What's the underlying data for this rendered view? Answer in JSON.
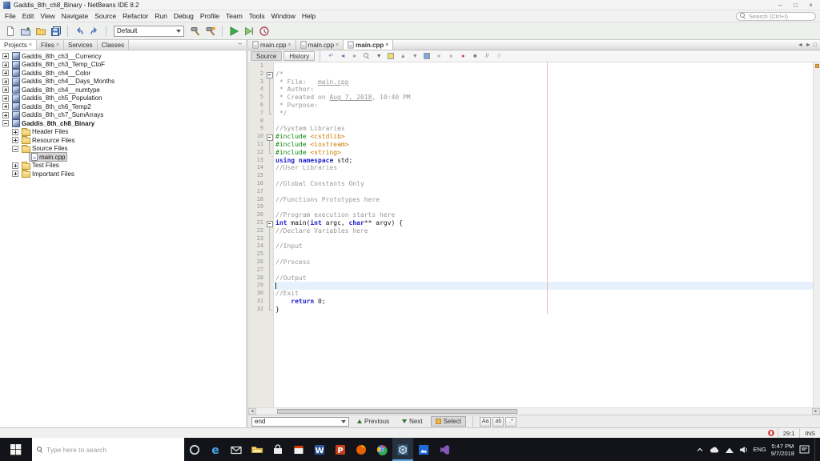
{
  "window": {
    "title": "Gaddis_8th_ch8_Binary - NetBeans IDE 8.2",
    "controls": {
      "minimize": "–",
      "maximize": "□",
      "close": "×"
    }
  },
  "menu_bar": {
    "items": [
      "File",
      "Edit",
      "View",
      "Navigate",
      "Source",
      "Refactor",
      "Run",
      "Debug",
      "Profile",
      "Team",
      "Tools",
      "Window",
      "Help"
    ],
    "search_placeholder": "Search (Ctrl+I)"
  },
  "toolbar": {
    "config_value": "Default",
    "items": [
      {
        "name": "new-file"
      },
      {
        "name": "new-project"
      },
      {
        "name": "open-project"
      },
      {
        "name": "save-all"
      },
      {
        "sep": true
      },
      {
        "name": "undo"
      },
      {
        "name": "redo"
      },
      {
        "sep": true
      },
      {
        "combo": true
      },
      {
        "name": "build-project"
      },
      {
        "name": "clean-build-project"
      },
      {
        "sep": true
      },
      {
        "name": "run-project"
      },
      {
        "name": "debug-project"
      },
      {
        "name": "profile-project"
      }
    ]
  },
  "left_panel": {
    "tabs": [
      {
        "label": "Projects",
        "closable": true,
        "active": true
      },
      {
        "label": "Files",
        "closable": true
      },
      {
        "label": "Services"
      },
      {
        "label": "Classes"
      }
    ],
    "tree": [
      {
        "label": "Gaddis_8th_ch3__Currency",
        "icon": "project",
        "toggle": "plus",
        "level": 0
      },
      {
        "label": "Gaddis_8th_ch3_Temp_CtoF",
        "icon": "project",
        "toggle": "plus",
        "level": 0
      },
      {
        "label": "Gaddis_8th_ch4__Color",
        "icon": "project",
        "toggle": "plus",
        "level": 0
      },
      {
        "label": "Gaddis_8th_ch4__Days_Months",
        "icon": "project",
        "toggle": "plus",
        "level": 0
      },
      {
        "label": "Gaddis_8th_ch4__numtype",
        "icon": "project",
        "toggle": "plus",
        "level": 0
      },
      {
        "label": "Gaddis_8th_ch5_Population",
        "icon": "project",
        "toggle": "plus",
        "level": 0
      },
      {
        "label": "Gaddis_8th_ch6_Temp2",
        "icon": "project",
        "toggle": "plus",
        "level": 0
      },
      {
        "label": "Gaddis_8th_ch7_SumArrays",
        "icon": "project",
        "toggle": "plus",
        "level": 0
      },
      {
        "label": "Gaddis_8th_ch8_Binary",
        "icon": "project",
        "toggle": "minus",
        "level": 0,
        "bold": true
      },
      {
        "label": "Header Files",
        "icon": "folder",
        "toggle": "plus",
        "level": 1
      },
      {
        "label": "Resource Files",
        "icon": "folder",
        "toggle": "plus",
        "level": 1
      },
      {
        "label": "Source Files",
        "icon": "folder",
        "toggle": "minus",
        "level": 1
      },
      {
        "label": "main.cpp",
        "icon": "cpp",
        "toggle": "none",
        "level": 2,
        "selected": true
      },
      {
        "label": "Test Files",
        "icon": "folder",
        "toggle": "plus",
        "level": 1
      },
      {
        "label": "Important Files",
        "icon": "folder",
        "toggle": "plus",
        "level": 1
      }
    ]
  },
  "editor": {
    "source_label": "Source",
    "history_label": "History",
    "tabs": [
      {
        "label": "main.cpp"
      },
      {
        "label": "main.cpp"
      },
      {
        "label": "main.cpp",
        "active": true
      }
    ],
    "toolbar_icons": [
      "last-edit-position",
      "back",
      "forward",
      "find-selection",
      "find-next-occurrence",
      "toggle-highlight-search",
      "previous-bookmark",
      "next-bookmark",
      "toggle-bookmark",
      "shift-line-left",
      "shift-line-right",
      "start-macro-recording",
      "stop-macro-recording",
      "comment-lines",
      "uncomment-lines"
    ],
    "current_line": 29,
    "code_lines": [
      {
        "fold": "",
        "tokens": []
      },
      {
        "fold": "start",
        "tokens": [
          [
            "/*",
            "c"
          ]
        ]
      },
      {
        "fold": "mid",
        "tokens": [
          [
            " * File:   ",
            "c"
          ],
          [
            "main.cpp",
            "cu"
          ]
        ]
      },
      {
        "fold": "mid",
        "tokens": [
          [
            " * Author:",
            "c"
          ]
        ]
      },
      {
        "fold": "mid",
        "tokens": [
          [
            " * Created on ",
            "c"
          ],
          [
            "Aug 7, 2018",
            "cu"
          ],
          [
            ", 10:40 PM",
            "c"
          ]
        ]
      },
      {
        "fold": "mid",
        "tokens": [
          [
            " * Purpose:",
            "c"
          ]
        ]
      },
      {
        "fold": "end",
        "tokens": [
          [
            " */",
            "c"
          ]
        ]
      },
      {
        "fold": "",
        "tokens": []
      },
      {
        "fold": "",
        "tokens": [
          [
            "//System Libraries",
            "c"
          ]
        ]
      },
      {
        "fold": "start",
        "tokens": [
          [
            "#include ",
            "p"
          ],
          [
            "<cstdlib>",
            "h"
          ]
        ]
      },
      {
        "fold": "mid",
        "tokens": [
          [
            "#include ",
            "p"
          ],
          [
            "<iostream>",
            "h"
          ]
        ]
      },
      {
        "fold": "end",
        "tokens": [
          [
            "#include ",
            "p"
          ],
          [
            "<string>",
            "h"
          ]
        ]
      },
      {
        "fold": "",
        "tokens": [
          [
            "using",
            "k"
          ],
          [
            " ",
            "n"
          ],
          [
            "namespace",
            "k"
          ],
          [
            " std;",
            "n"
          ]
        ]
      },
      {
        "fold": "",
        "tokens": [
          [
            "//User Libraries",
            "c"
          ]
        ]
      },
      {
        "fold": "",
        "tokens": []
      },
      {
        "fold": "",
        "tokens": [
          [
            "//Global Constants Only",
            "c"
          ]
        ]
      },
      {
        "fold": "",
        "tokens": []
      },
      {
        "fold": "",
        "tokens": [
          [
            "//Functions Prototypes here",
            "c"
          ]
        ]
      },
      {
        "fold": "",
        "tokens": []
      },
      {
        "fold": "",
        "tokens": [
          [
            "//Program execution starts here",
            "c"
          ]
        ]
      },
      {
        "fold": "start",
        "tokens": [
          [
            "int",
            "k"
          ],
          [
            " main(",
            "n"
          ],
          [
            "int",
            "k"
          ],
          [
            " argc, ",
            "n"
          ],
          [
            "char",
            "k"
          ],
          [
            "** argv) {",
            "n"
          ]
        ]
      },
      {
        "fold": "mid",
        "tokens": [
          [
            "//Declare Variables here",
            "c"
          ]
        ]
      },
      {
        "fold": "mid",
        "tokens": []
      },
      {
        "fold": "mid",
        "tokens": [
          [
            "//Input",
            "c"
          ]
        ]
      },
      {
        "fold": "mid",
        "tokens": []
      },
      {
        "fold": "mid",
        "tokens": [
          [
            "//Process",
            "c"
          ]
        ]
      },
      {
        "fold": "mid",
        "tokens": []
      },
      {
        "fold": "mid",
        "tokens": [
          [
            "//Output",
            "c"
          ]
        ]
      },
      {
        "fold": "mid",
        "tokens": []
      },
      {
        "fold": "mid",
        "tokens": [
          [
            "//Exit",
            "c"
          ]
        ]
      },
      {
        "fold": "mid",
        "tokens": [
          [
            "    ",
            "n"
          ],
          [
            "return",
            "k"
          ],
          [
            " 0;",
            "n"
          ]
        ]
      },
      {
        "fold": "end",
        "tokens": [
          [
            "}",
            "n"
          ]
        ]
      }
    ],
    "find_bar": {
      "query": "end",
      "previous": "Previous",
      "next": "Next",
      "select": "Select",
      "toggles": [
        {
          "label": "Aa",
          "name": "match-case"
        },
        {
          "label": "ab",
          "name": "whole-words"
        },
        {
          "label": ".*",
          "name": "regular-expression"
        }
      ]
    }
  },
  "status_bar": {
    "caret": "29:1",
    "mode": "INS"
  },
  "taskbar": {
    "search_placeholder": "Type here to search",
    "apps": [
      {
        "name": "cortana"
      },
      {
        "name": "edge"
      },
      {
        "name": "mail"
      },
      {
        "name": "file-explorer"
      },
      {
        "name": "store"
      },
      {
        "name": "calendar"
      },
      {
        "name": "word"
      },
      {
        "name": "powerpoint"
      },
      {
        "name": "firefox"
      },
      {
        "name": "chrome"
      },
      {
        "name": "netbeans",
        "active": true
      },
      {
        "name": "photos"
      },
      {
        "name": "visual-studio"
      }
    ],
    "tray": {
      "language": "ENG",
      "time": "5:47 PM",
      "date": "9/7/2018"
    }
  }
}
